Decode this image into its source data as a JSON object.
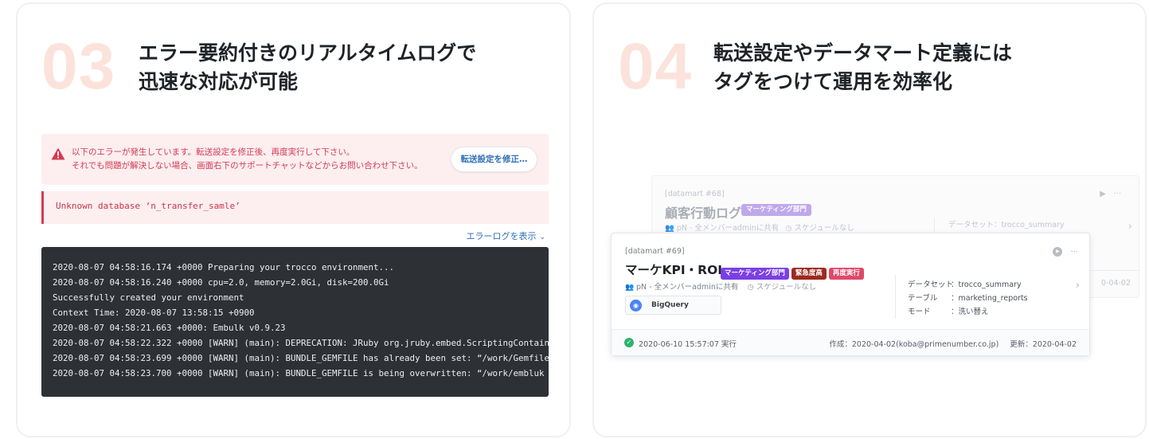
{
  "left": {
    "number": "03",
    "heading": [
      "エラー要約付きのリアルタイムログで",
      "迅速な対応が可能"
    ],
    "alert": {
      "line1": "以下のエラーが発生しています。転送設定を修正後、再度実行して下さい。",
      "line2": "それでも問題が解決しない場合、画面右下のサポートチャットなどからお問い合わせ下さい。",
      "button": "転送設定を修正…"
    },
    "error_message": "Unknown database ‘n_transfer_samle’",
    "show_log_label": "エラーログを表示",
    "log_lines": [
      "2020-08-07 04:58:16.174 +0000 Preparing your trocco environment...",
      "2020-08-07 04:58:16.240 +0000 cpu=2.0, memory=2.0Gi, disk=200.0Gi",
      "Successfully created your environment",
      "Context Time: 2020-08-07 13:58:15 +0900",
      "2020-08-07 04:58:21.663 +0000: Embulk v0.9.23",
      "2020-08-07 04:58:22.322 +0000 [WARN] (main): DEPRECATION: JRuby org.jruby.embed.ScriptingContain",
      "2020-08-07 04:58:23.699 +0000 [WARN] (main): BUNDLE_GEMFILE has already been set: “/work/Gemfile",
      "2020-08-07 04:58:23.700 +0000 [WARN] (main): BUNDLE_GEMFILE is being overwritten: “/work/embluk"
    ]
  },
  "right": {
    "number": "04",
    "heading": [
      "転送設定やデータマート定義には",
      "タグをつけて運用を効率化"
    ],
    "back_card": {
      "id": "[datamart #68]",
      "title": "顧客行動ログ",
      "tag": "マーケティング部門",
      "share": "pN - 全メンバーadminに共有",
      "schedule": "スケジュールなし",
      "dataset": "データセット：trocco_summary",
      "date": "0-04-02"
    },
    "front_card": {
      "id": "[datamart #69]",
      "title": "マーケKPI・ROI",
      "tags": [
        {
          "label": "マーケティング部門",
          "color": "#7b3fe4"
        },
        {
          "label": "緊急度高",
          "color": "#9b2a1f"
        },
        {
          "label": "再度実行",
          "color": "#e0486b"
        }
      ],
      "share": "pN - 全メンバーadminに共有",
      "schedule": "スケジュールなし",
      "connector": "BigQuery",
      "meta": [
        {
          "key": "データセット",
          "value": "：trocco_summary"
        },
        {
          "key": "テーブル",
          "value": "：marketing_reports"
        },
        {
          "key": "モード",
          "value": "：洗い替え"
        }
      ],
      "last_run": "2020-06-10 15:57:07 実行",
      "created": "作成：2020-04-02(koba@primenumber.co.jp)",
      "updated": "更新：2020-04-02"
    }
  }
}
